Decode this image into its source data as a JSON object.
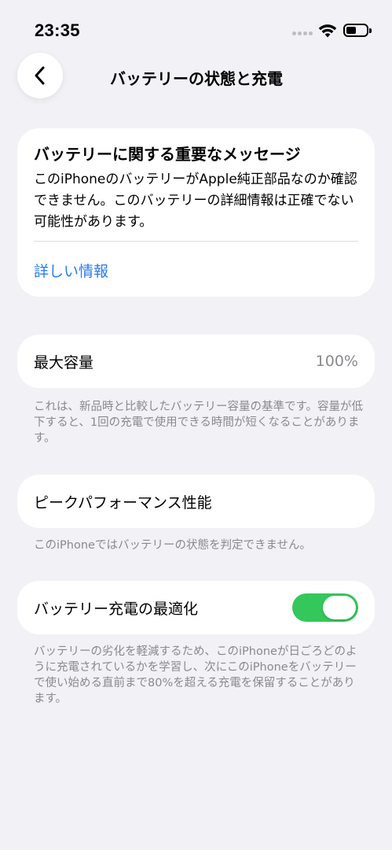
{
  "status_bar": {
    "time": "23:35",
    "battery_level": 0.5
  },
  "nav": {
    "title": "バッテリーの状態と充電"
  },
  "message_card": {
    "title": "バッテリーに関する重要なメッセージ",
    "body": "このiPhoneのバッテリーがApple純正部品なのか確認できません。このバッテリーの詳細情報は正確でない可能性があります。",
    "link_label": "詳しい情報"
  },
  "maximum_capacity": {
    "label": "最大容量",
    "value": "100%",
    "footnote": "これは、新品時と比較したバッテリー容量の基準です。容量が低下すると、1回の充電で使用できる時間が短くなることがあります。"
  },
  "peak_performance": {
    "label": "ピークパフォーマンス性能",
    "footnote": "このiPhoneではバッテリーの状態を判定できません。"
  },
  "optimized_charging": {
    "label": "バッテリー充電の最適化",
    "enabled": true,
    "footnote": "バッテリーの劣化を軽減するため、このiPhoneが日ごろどのように充電されているかを学習し、次にこのiPhoneをバッテリーで使い始める直前まで80%を超える充電を保留することがあります。"
  },
  "colors": {
    "accent": "#2a7cf0",
    "toggle_on": "#34c759",
    "background": "#f2f1f6"
  },
  "icons": {
    "back": "chevron-left-icon",
    "wifi": "wifi-icon",
    "battery": "battery-icon",
    "signal": "signal-dots-icon"
  }
}
